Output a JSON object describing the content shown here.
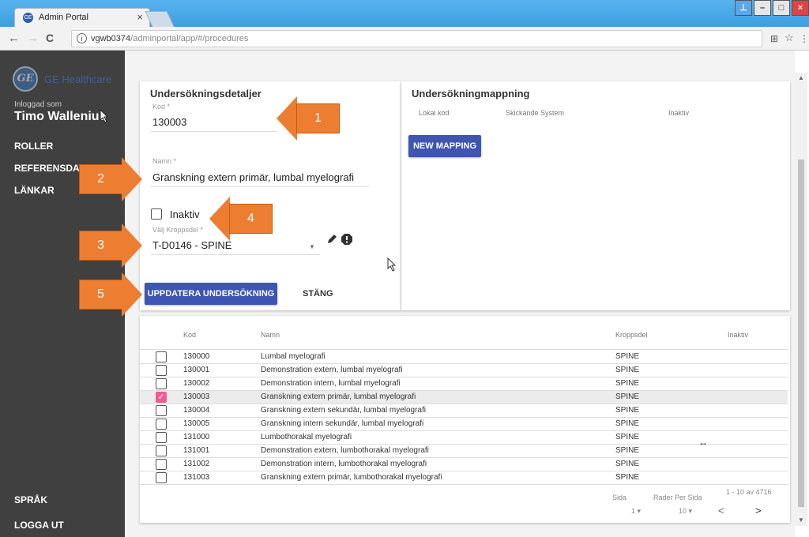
{
  "browser": {
    "tab_title": "Admin Portal",
    "tab_close": "×",
    "url_host": "vgwb0374",
    "url_path": "/adminportal/app/#/procedures",
    "back": "←",
    "forward": "→",
    "reload": "C",
    "info": "i",
    "translate": "⊞",
    "star": "☆",
    "menu": "⋮",
    "win_user": "⊥",
    "win_min": "–",
    "win_max": "□",
    "win_close": "×"
  },
  "sidebar": {
    "brand": "GE Healthcare",
    "logo_text": "GE",
    "logged_in_label": "Inloggad som",
    "user_name": "Timo Wallenius",
    "items": [
      "ROLLER",
      "REFERENSDATA",
      "LÄNKAR"
    ],
    "bottom_items": [
      "SPRÅK",
      "LOGGA UT"
    ]
  },
  "details": {
    "title": "Undersökningsdetaljer",
    "kod_label": "Kod *",
    "kod_value": "130003",
    "namn_label": "Namn *",
    "namn_value": "Granskning extern primär, lumbal myelografi",
    "inaktiv_label": "Inaktiv",
    "kroppsdel_label": "Välj Kroppsdel *",
    "kroppsdel_value": "T-D0146 - SPINE",
    "update_button": "UPPDATERA UNDERSÖKNING",
    "close_button": "STÄNG"
  },
  "mapping": {
    "title": "Undersökningmappning",
    "columns": [
      "Lokal kod",
      "Skickande System",
      "Inaktiv"
    ],
    "new_button": "NEW MAPPING"
  },
  "table": {
    "headers": {
      "kod": "Kod",
      "namn": "Namn",
      "kroppsdel": "Kroppsdel",
      "inaktiv": "Inaktiv"
    },
    "rows": [
      {
        "kod": "130000",
        "namn": "Lumbal myelografi",
        "kroppsdel": "SPINE",
        "checked": false
      },
      {
        "kod": "130001",
        "namn": "Demonstration extern, lumbal myelografi",
        "kroppsdel": "SPINE",
        "checked": false
      },
      {
        "kod": "130002",
        "namn": "Demonstration intern, lumbal myelografi",
        "kroppsdel": "SPINE",
        "checked": false
      },
      {
        "kod": "130003",
        "namn": "Granskning extern primär, lumbal myelografi",
        "kroppsdel": "SPINE",
        "checked": true
      },
      {
        "kod": "130004",
        "namn": "Granskning extern sekundär, lumbal myelografi",
        "kroppsdel": "SPINE",
        "checked": false
      },
      {
        "kod": "130005",
        "namn": "Granskning intern sekundär, lumbal myelografi",
        "kroppsdel": "SPINE",
        "checked": false
      },
      {
        "kod": "131000",
        "namn": "Lumbothorakal myelografi",
        "kroppsdel": "SPINE",
        "checked": false
      },
      {
        "kod": "131001",
        "namn": "Demonstration extern, lumbothorakal myelografi",
        "kroppsdel": "SPINE",
        "checked": false
      },
      {
        "kod": "131002",
        "namn": "Demonstration intern, lumbothorakal myelografi",
        "kroppsdel": "SPINE",
        "checked": false
      },
      {
        "kod": "131003",
        "namn": "Granskning extern primär, lumbothorakal myelografi",
        "kroppsdel": "SPINE",
        "checked": false
      }
    ],
    "pager": {
      "range": "1 - 10 av 4716",
      "page_label": "Sida",
      "page_value": "1",
      "rows_label": "Rader Per Sida",
      "rows_value": "10",
      "prev": "<",
      "next": ">"
    }
  },
  "callouts": [
    "1",
    "2",
    "3",
    "4",
    "5"
  ],
  "colors": {
    "accent": "#3e55b1",
    "sidebar": "#404040",
    "callout": "#ed7d31",
    "checkbox_checked": "#f25a93"
  }
}
